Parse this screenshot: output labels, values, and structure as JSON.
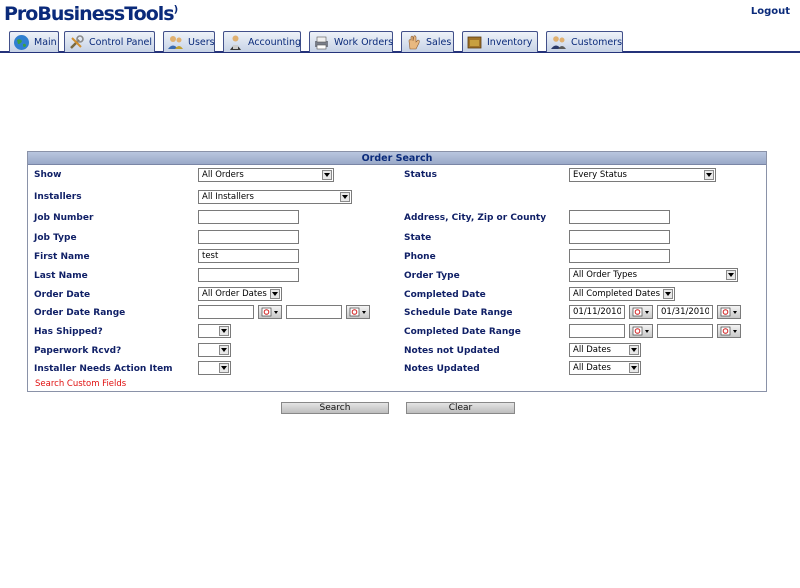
{
  "app": {
    "logo_text": "ProBusinessTools",
    "logo_mark": ")",
    "logout_label": "Logout"
  },
  "nav": {
    "tabs": [
      {
        "label": "Main",
        "icon": "globe-icon"
      },
      {
        "label": "Control Panel",
        "icon": "tools-icon"
      },
      {
        "label": "Users",
        "icon": "users-icon"
      },
      {
        "label": "Accounting",
        "icon": "accountant-icon"
      },
      {
        "label": "Work Orders",
        "icon": "printer-icon"
      },
      {
        "label": "Sales",
        "icon": "hand-icon"
      },
      {
        "label": "Inventory",
        "icon": "box-icon"
      },
      {
        "label": "Customers",
        "icon": "customers-icon"
      }
    ]
  },
  "search": {
    "title": "Order Search",
    "show": {
      "label": "Show",
      "value": "All Orders"
    },
    "status": {
      "label": "Status",
      "value": "Every Status"
    },
    "installers": {
      "label": "Installers",
      "value": "All Installers"
    },
    "job_number": {
      "label": "Job Number",
      "value": ""
    },
    "address": {
      "label": "Address, City, Zip or County",
      "value": ""
    },
    "job_type": {
      "label": "Job Type",
      "value": ""
    },
    "state": {
      "label": "State",
      "value": ""
    },
    "first_name": {
      "label": "First Name",
      "value": "test"
    },
    "phone": {
      "label": "Phone",
      "value": ""
    },
    "last_name": {
      "label": "Last Name",
      "value": ""
    },
    "order_type": {
      "label": "Order Type",
      "value": "All Order Types"
    },
    "order_date": {
      "label": "Order Date",
      "value": "All Order Dates"
    },
    "completed_date": {
      "label": "Completed Date",
      "value": "All Completed Dates"
    },
    "order_date_range": {
      "label": "Order Date Range",
      "from": "",
      "to": ""
    },
    "schedule_date_range": {
      "label": "Schedule Date Range",
      "from": "01/11/2010",
      "to": "01/31/2010"
    },
    "has_shipped": {
      "label": "Has Shipped?",
      "value": ""
    },
    "completed_date_range": {
      "label": "Completed Date Range",
      "from": "",
      "to": ""
    },
    "paperwork_rcvd": {
      "label": "Paperwork Rcvd?",
      "value": ""
    },
    "notes_not_updated": {
      "label": "Notes not Updated",
      "value": "All Dates"
    },
    "installer_action": {
      "label": "Installer Needs Action Item",
      "value": ""
    },
    "notes_updated": {
      "label": "Notes Updated",
      "value": "All Dates"
    },
    "custom_fields_link": "Search Custom Fields"
  },
  "buttons": {
    "search_label": "Search",
    "clear_label": "Clear"
  }
}
